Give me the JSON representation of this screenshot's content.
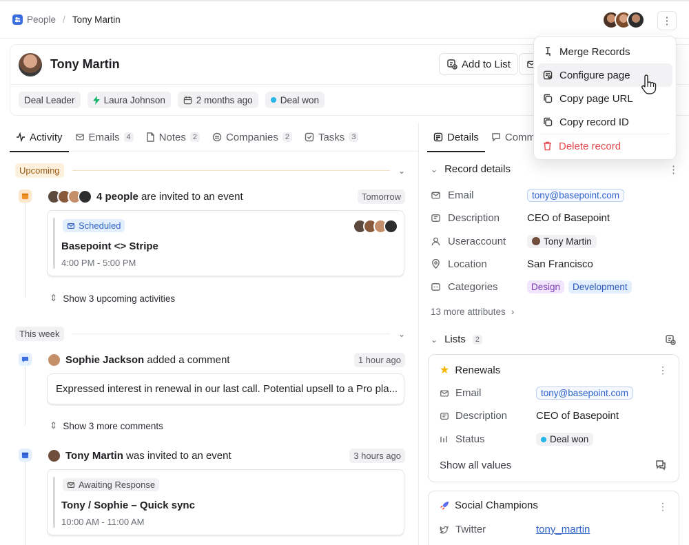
{
  "breadcrumb": {
    "root": "People",
    "current": "Tony Martin"
  },
  "record": {
    "name": "Tony Martin"
  },
  "header_buttons": {
    "add_to_list": "Add to List"
  },
  "tags": [
    {
      "label": "Deal Leader",
      "icon": ""
    },
    {
      "label": "Laura Johnson",
      "icon": "bolt-icon"
    },
    {
      "label": "2 months ago",
      "icon": "calendar-icon"
    },
    {
      "label": "Deal won",
      "icon": "status-dot",
      "color": "#22b5e6"
    }
  ],
  "left_tabs": [
    {
      "label": "Activity",
      "count": ""
    },
    {
      "label": "Emails",
      "count": "4"
    },
    {
      "label": "Notes",
      "count": "2"
    },
    {
      "label": "Companies",
      "count": "2"
    },
    {
      "label": "Tasks",
      "count": "3"
    }
  ],
  "upcoming": {
    "label": "Upcoming",
    "event_text_bold": "4 people",
    "event_text": " are invited to an event",
    "time": "Tomorrow",
    "card": {
      "status": "Scheduled",
      "title": "Basepoint <> Stripe",
      "time": "4:00 PM - 5:00 PM"
    },
    "show_more": "Show 3 upcoming activities"
  },
  "this_week": {
    "label": "This week",
    "comment": {
      "author": "Sophie Jackson",
      "action": " added a comment",
      "time": "1 hour ago",
      "text": "Expressed interest in renewal in our last call. Potential upsell to a Pro pla..."
    },
    "show_more": "Show 3 more comments",
    "invite": {
      "author": "Tony Martin",
      "action": " was invited to an event",
      "time": "3 hours ago",
      "card": {
        "status": "Awaiting Response",
        "title": "Tony / Sophie – Quick sync",
        "time": "10:00 AM - 11:00 AM"
      }
    }
  },
  "right_tabs": [
    {
      "label": "Details"
    },
    {
      "label": "Comm"
    }
  ],
  "record_details": {
    "title": "Record details",
    "attributes": [
      {
        "label": "Email",
        "value": "tony@basepoint.com",
        "icon": "mail-icon"
      },
      {
        "label": "Description",
        "value": "CEO of Basepoint",
        "icon": "text-icon"
      },
      {
        "label": "Useraccount",
        "value": "Tony Martin",
        "icon": "user-icon"
      },
      {
        "label": "Location",
        "value": "San Francisco",
        "icon": "pin-icon"
      },
      {
        "label": "Categories",
        "icon": "tag-icon",
        "values": [
          "Design",
          "Development"
        ]
      }
    ],
    "more": "13 more attributes"
  },
  "lists": {
    "title": "Lists",
    "count": "2",
    "renewals": {
      "title": "Renewals",
      "email_label": "Email",
      "email": "tony@basepoint.com",
      "desc_label": "Description",
      "desc": "CEO of Basepoint",
      "status_label": "Status",
      "status": "Deal won",
      "show_all": "Show all values"
    },
    "social": {
      "title": "Social Champions",
      "twitter_label": "Twitter",
      "twitter": "tony_martin"
    }
  },
  "menu": {
    "merge": "Merge Records",
    "configure": "Configure page",
    "copy_url": "Copy page URL",
    "copy_id": "Copy record ID",
    "delete": "Delete record"
  },
  "colors": {
    "accent_blue": "#3b6fe0",
    "danger": "#e5484d",
    "upcoming_bg": "#fdf0dd",
    "design_pill": "#f1e6fb",
    "development_pill": "#e4effd"
  }
}
